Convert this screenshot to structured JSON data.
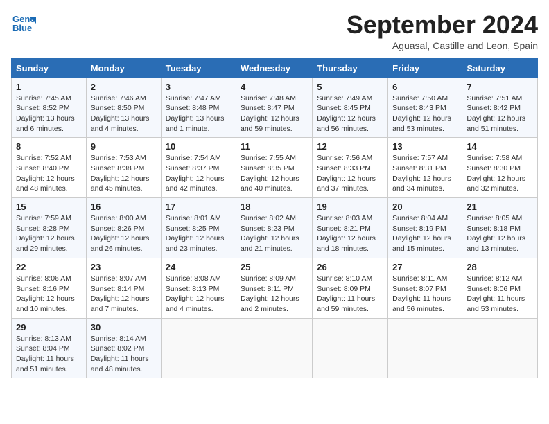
{
  "header": {
    "logo_line1": "General",
    "logo_line2": "Blue",
    "month_title": "September 2024",
    "subtitle": "Aguasal, Castille and Leon, Spain"
  },
  "columns": [
    "Sunday",
    "Monday",
    "Tuesday",
    "Wednesday",
    "Thursday",
    "Friday",
    "Saturday"
  ],
  "weeks": [
    [
      {
        "day": "1",
        "sunrise": "Sunrise: 7:45 AM",
        "sunset": "Sunset: 8:52 PM",
        "daylight": "Daylight: 13 hours and 6 minutes."
      },
      {
        "day": "2",
        "sunrise": "Sunrise: 7:46 AM",
        "sunset": "Sunset: 8:50 PM",
        "daylight": "Daylight: 13 hours and 4 minutes."
      },
      {
        "day": "3",
        "sunrise": "Sunrise: 7:47 AM",
        "sunset": "Sunset: 8:48 PM",
        "daylight": "Daylight: 13 hours and 1 minute."
      },
      {
        "day": "4",
        "sunrise": "Sunrise: 7:48 AM",
        "sunset": "Sunset: 8:47 PM",
        "daylight": "Daylight: 12 hours and 59 minutes."
      },
      {
        "day": "5",
        "sunrise": "Sunrise: 7:49 AM",
        "sunset": "Sunset: 8:45 PM",
        "daylight": "Daylight: 12 hours and 56 minutes."
      },
      {
        "day": "6",
        "sunrise": "Sunrise: 7:50 AM",
        "sunset": "Sunset: 8:43 PM",
        "daylight": "Daylight: 12 hours and 53 minutes."
      },
      {
        "day": "7",
        "sunrise": "Sunrise: 7:51 AM",
        "sunset": "Sunset: 8:42 PM",
        "daylight": "Daylight: 12 hours and 51 minutes."
      }
    ],
    [
      {
        "day": "8",
        "sunrise": "Sunrise: 7:52 AM",
        "sunset": "Sunset: 8:40 PM",
        "daylight": "Daylight: 12 hours and 48 minutes."
      },
      {
        "day": "9",
        "sunrise": "Sunrise: 7:53 AM",
        "sunset": "Sunset: 8:38 PM",
        "daylight": "Daylight: 12 hours and 45 minutes."
      },
      {
        "day": "10",
        "sunrise": "Sunrise: 7:54 AM",
        "sunset": "Sunset: 8:37 PM",
        "daylight": "Daylight: 12 hours and 42 minutes."
      },
      {
        "day": "11",
        "sunrise": "Sunrise: 7:55 AM",
        "sunset": "Sunset: 8:35 PM",
        "daylight": "Daylight: 12 hours and 40 minutes."
      },
      {
        "day": "12",
        "sunrise": "Sunrise: 7:56 AM",
        "sunset": "Sunset: 8:33 PM",
        "daylight": "Daylight: 12 hours and 37 minutes."
      },
      {
        "day": "13",
        "sunrise": "Sunrise: 7:57 AM",
        "sunset": "Sunset: 8:31 PM",
        "daylight": "Daylight: 12 hours and 34 minutes."
      },
      {
        "day": "14",
        "sunrise": "Sunrise: 7:58 AM",
        "sunset": "Sunset: 8:30 PM",
        "daylight": "Daylight: 12 hours and 32 minutes."
      }
    ],
    [
      {
        "day": "15",
        "sunrise": "Sunrise: 7:59 AM",
        "sunset": "Sunset: 8:28 PM",
        "daylight": "Daylight: 12 hours and 29 minutes."
      },
      {
        "day": "16",
        "sunrise": "Sunrise: 8:00 AM",
        "sunset": "Sunset: 8:26 PM",
        "daylight": "Daylight: 12 hours and 26 minutes."
      },
      {
        "day": "17",
        "sunrise": "Sunrise: 8:01 AM",
        "sunset": "Sunset: 8:25 PM",
        "daylight": "Daylight: 12 hours and 23 minutes."
      },
      {
        "day": "18",
        "sunrise": "Sunrise: 8:02 AM",
        "sunset": "Sunset: 8:23 PM",
        "daylight": "Daylight: 12 hours and 21 minutes."
      },
      {
        "day": "19",
        "sunrise": "Sunrise: 8:03 AM",
        "sunset": "Sunset: 8:21 PM",
        "daylight": "Daylight: 12 hours and 18 minutes."
      },
      {
        "day": "20",
        "sunrise": "Sunrise: 8:04 AM",
        "sunset": "Sunset: 8:19 PM",
        "daylight": "Daylight: 12 hours and 15 minutes."
      },
      {
        "day": "21",
        "sunrise": "Sunrise: 8:05 AM",
        "sunset": "Sunset: 8:18 PM",
        "daylight": "Daylight: 12 hours and 13 minutes."
      }
    ],
    [
      {
        "day": "22",
        "sunrise": "Sunrise: 8:06 AM",
        "sunset": "Sunset: 8:16 PM",
        "daylight": "Daylight: 12 hours and 10 minutes."
      },
      {
        "day": "23",
        "sunrise": "Sunrise: 8:07 AM",
        "sunset": "Sunset: 8:14 PM",
        "daylight": "Daylight: 12 hours and 7 minutes."
      },
      {
        "day": "24",
        "sunrise": "Sunrise: 8:08 AM",
        "sunset": "Sunset: 8:13 PM",
        "daylight": "Daylight: 12 hours and 4 minutes."
      },
      {
        "day": "25",
        "sunrise": "Sunrise: 8:09 AM",
        "sunset": "Sunset: 8:11 PM",
        "daylight": "Daylight: 12 hours and 2 minutes."
      },
      {
        "day": "26",
        "sunrise": "Sunrise: 8:10 AM",
        "sunset": "Sunset: 8:09 PM",
        "daylight": "Daylight: 11 hours and 59 minutes."
      },
      {
        "day": "27",
        "sunrise": "Sunrise: 8:11 AM",
        "sunset": "Sunset: 8:07 PM",
        "daylight": "Daylight: 11 hours and 56 minutes."
      },
      {
        "day": "28",
        "sunrise": "Sunrise: 8:12 AM",
        "sunset": "Sunset: 8:06 PM",
        "daylight": "Daylight: 11 hours and 53 minutes."
      }
    ],
    [
      {
        "day": "29",
        "sunrise": "Sunrise: 8:13 AM",
        "sunset": "Sunset: 8:04 PM",
        "daylight": "Daylight: 11 hours and 51 minutes."
      },
      {
        "day": "30",
        "sunrise": "Sunrise: 8:14 AM",
        "sunset": "Sunset: 8:02 PM",
        "daylight": "Daylight: 11 hours and 48 minutes."
      },
      null,
      null,
      null,
      null,
      null
    ]
  ]
}
